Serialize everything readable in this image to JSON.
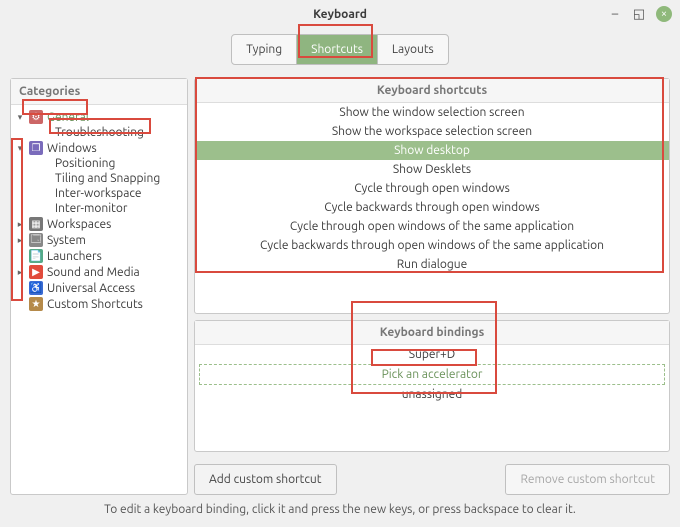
{
  "window": {
    "title": "Keyboard"
  },
  "tabs": {
    "typing": "Typing",
    "shortcuts": "Shortcuts",
    "layouts": "Layouts"
  },
  "sidebar": {
    "header": "Categories",
    "items": [
      {
        "label": "General",
        "icon": "general",
        "expandable": true,
        "expanded": true,
        "selected": true,
        "depth": 0
      },
      {
        "label": "Troubleshooting",
        "icon": "",
        "depth": 1
      },
      {
        "label": "Windows",
        "icon": "windows",
        "expandable": true,
        "expanded": true,
        "depth": 0
      },
      {
        "label": "Positioning",
        "icon": "",
        "depth": 1
      },
      {
        "label": "Tiling and Snapping",
        "icon": "",
        "depth": 1
      },
      {
        "label": "Inter-workspace",
        "icon": "",
        "depth": 1
      },
      {
        "label": "Inter-monitor",
        "icon": "",
        "depth": 1
      },
      {
        "label": "Workspaces",
        "icon": "workspaces",
        "expandable": true,
        "expanded": false,
        "depth": 0
      },
      {
        "label": "System",
        "icon": "system",
        "expandable": true,
        "expanded": false,
        "depth": 0
      },
      {
        "label": "Launchers",
        "icon": "launchers",
        "expandable": false,
        "depth": 0
      },
      {
        "label": "Sound and Media",
        "icon": "sound",
        "expandable": true,
        "expanded": false,
        "depth": 0
      },
      {
        "label": "Universal Access",
        "icon": "access",
        "expandable": false,
        "depth": 0
      },
      {
        "label": "Custom Shortcuts",
        "icon": "custom",
        "expandable": false,
        "depth": 0
      }
    ]
  },
  "shortcuts": {
    "header": "Keyboard shortcuts",
    "rows": [
      "Show the window selection screen",
      "Show the workspace selection screen",
      "Show desktop",
      "Show Desklets",
      "Cycle through open windows",
      "Cycle backwards through open windows",
      "Cycle through open windows of the same application",
      "Cycle backwards through open windows of the same application",
      "Run dialogue"
    ],
    "selected_index": 2
  },
  "bindings": {
    "header": "Keyboard bindings",
    "rows": [
      {
        "text": "Super+D",
        "state": "assigned"
      },
      {
        "text": "Pick an accelerator",
        "state": "pick"
      },
      {
        "text": "unassigned",
        "state": "unassigned"
      }
    ]
  },
  "buttons": {
    "add": "Add custom shortcut",
    "remove": "Remove custom shortcut"
  },
  "hint": "To edit a keyboard binding, click it and press the new keys, or press backspace to clear it.",
  "colors": {
    "accent": "#8fb580"
  }
}
